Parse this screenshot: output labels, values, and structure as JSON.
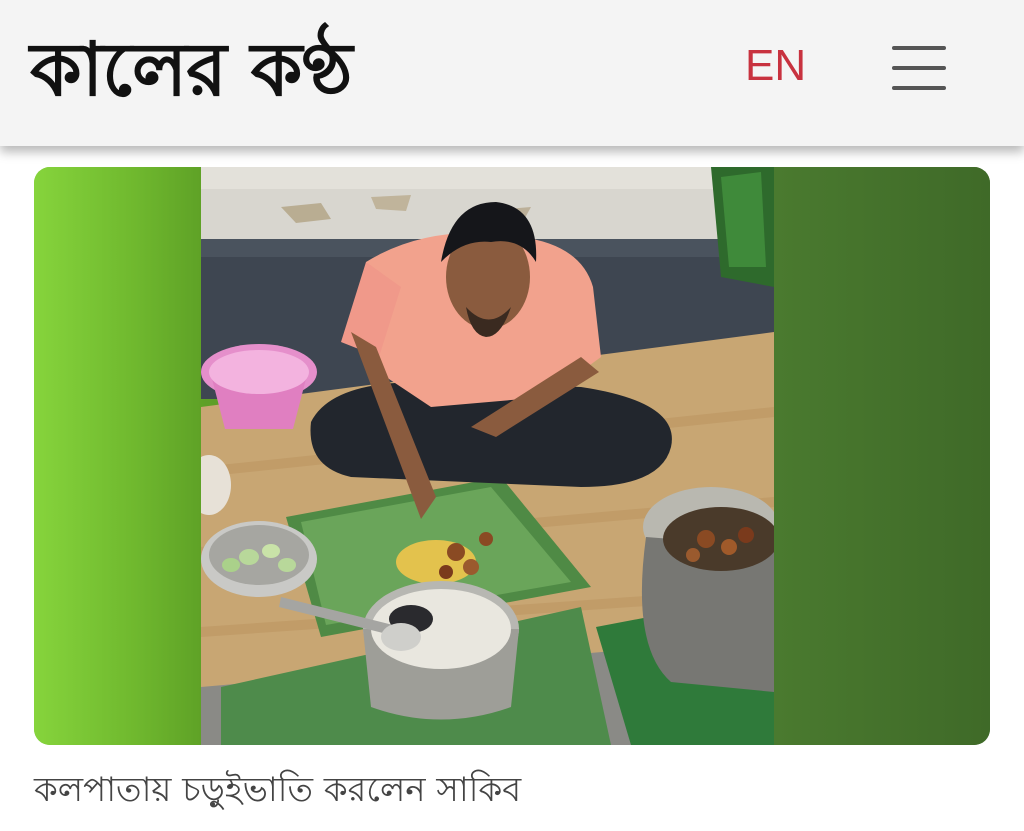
{
  "header": {
    "logo_text": "কালের কণ্ঠ",
    "language_toggle": "EN",
    "menu_icon": "hamburger-menu-icon",
    "colors": {
      "background": "#f4f4f4",
      "language_toggle": "#c8323f",
      "logo": "#111111"
    }
  },
  "article": {
    "caption": "কলপাতায় চড়ুইভাতি করলেন সাকিব"
  }
}
